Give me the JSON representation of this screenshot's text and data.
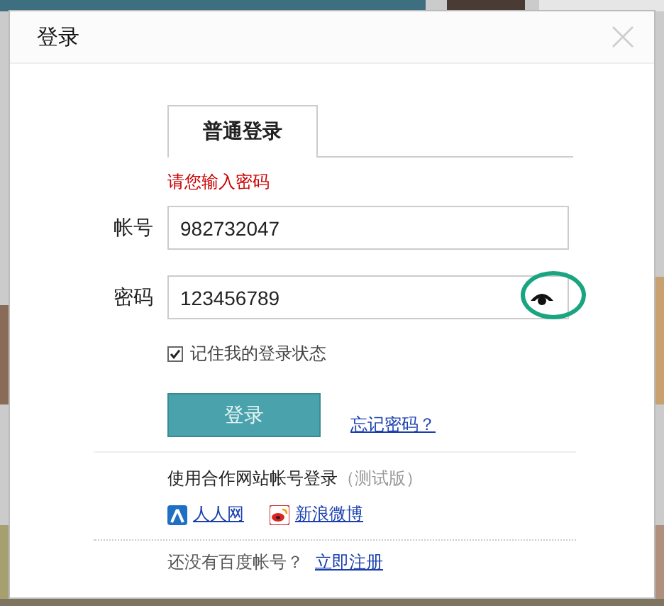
{
  "dialog": {
    "title": "登录"
  },
  "tabs": [
    {
      "label": "普通登录",
      "selected": true
    }
  ],
  "error": "请您输入密码",
  "fields": [
    {
      "kind": "text",
      "label": "帐号",
      "value": "982732047",
      "highlighted": false
    },
    {
      "kind": "password",
      "label": "密码",
      "value": "123456789",
      "highlighted": true
    }
  ],
  "remember": {
    "label": "记住我的登录状态",
    "checked": true
  },
  "login_button": "登录",
  "forgot_link": "忘记密码？",
  "partner": {
    "title": "使用合作网站帐号登录",
    "note": "（测试版）",
    "links": [
      {
        "kind": "renren",
        "label": "人人网"
      },
      {
        "kind": "weibo",
        "label": "新浪微博"
      }
    ]
  },
  "register": {
    "prompt": "还没有百度帐号？",
    "link": "立即注册"
  }
}
